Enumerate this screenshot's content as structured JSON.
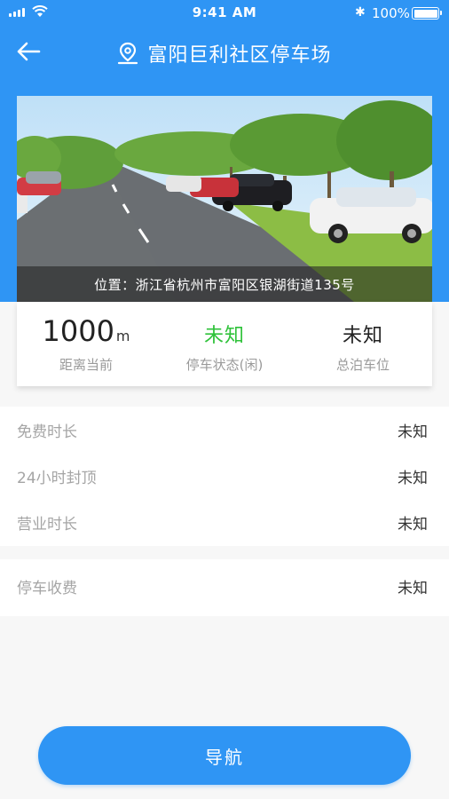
{
  "status_bar": {
    "time": "9:41 AM",
    "battery_pct": "100%"
  },
  "header": {
    "title": "富阳巨利社区停车场"
  },
  "photo": {
    "address": "位置：浙江省杭州市富阳区银湖街道135号"
  },
  "stats": {
    "distance": {
      "value": "1000",
      "unit": "m",
      "label": "距离当前"
    },
    "status": {
      "value": "未知",
      "label": "停车状态(闲)"
    },
    "total": {
      "value": "未知",
      "label": "总泊车位"
    }
  },
  "info": [
    {
      "label": "免费时长",
      "value": "未知"
    },
    {
      "label": "24小时封顶",
      "value": "未知"
    },
    {
      "label": "营业时长",
      "value": "未知"
    }
  ],
  "fee": {
    "label": "停车收费",
    "value": "未知"
  },
  "navigate_label": "导航",
  "colors": {
    "primary": "#2f95f4",
    "status_green": "#2fc23a"
  }
}
